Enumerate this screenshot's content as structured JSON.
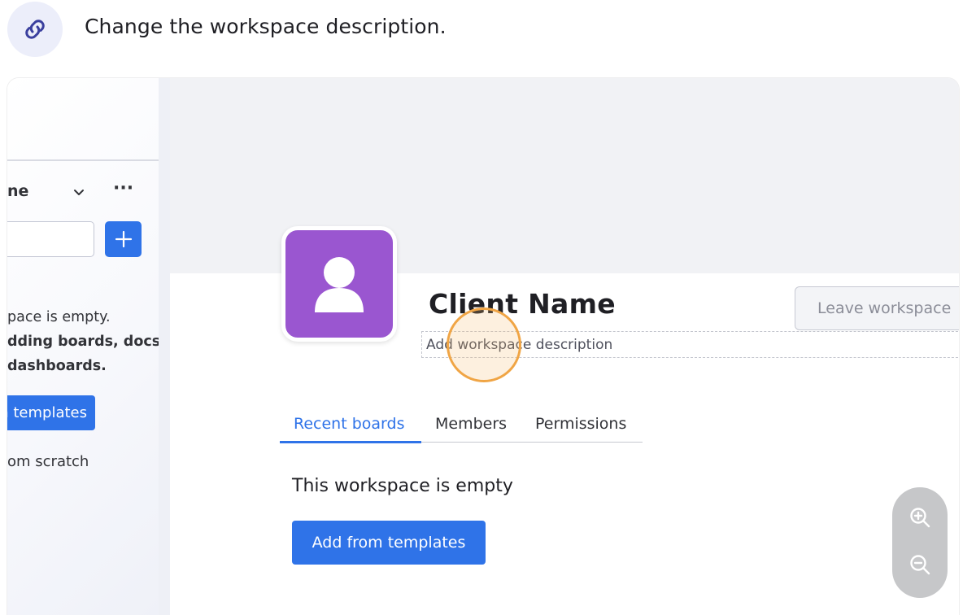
{
  "instruction": {
    "icon": "link-icon",
    "text": "Change the workspace description."
  },
  "sidebar": {
    "workspace_name_partial": "ne",
    "chevron_icon": "chevron-down-icon",
    "more_icon": "more-horizontal-icon",
    "more_label": "···",
    "search_placeholder": "",
    "add_icon": "plus-icon",
    "empty_lines": [
      "pace is empty.",
      "dding boards, docs,",
      "dashboards."
    ],
    "templates_button_partial": "n templates",
    "scratch_partial": "om scratch"
  },
  "workspace": {
    "title": "Client Name",
    "avatar_icon": "person-icon",
    "avatar_color": "#9a56d0",
    "leave_button": "Leave workspace",
    "description_placeholder": "Add workspace description"
  },
  "tabs": [
    {
      "label": "Recent boards",
      "active": true
    },
    {
      "label": "Members",
      "active": false
    },
    {
      "label": "Permissions",
      "active": false
    }
  ],
  "content": {
    "empty_heading": "This workspace is empty",
    "add_templates_button": "Add from templates"
  },
  "zoom": {
    "in_icon": "zoom-in-icon",
    "out_icon": "zoom-out-icon"
  },
  "colors": {
    "accent": "#2f73e8",
    "highlight_ring": "#f0a545"
  }
}
